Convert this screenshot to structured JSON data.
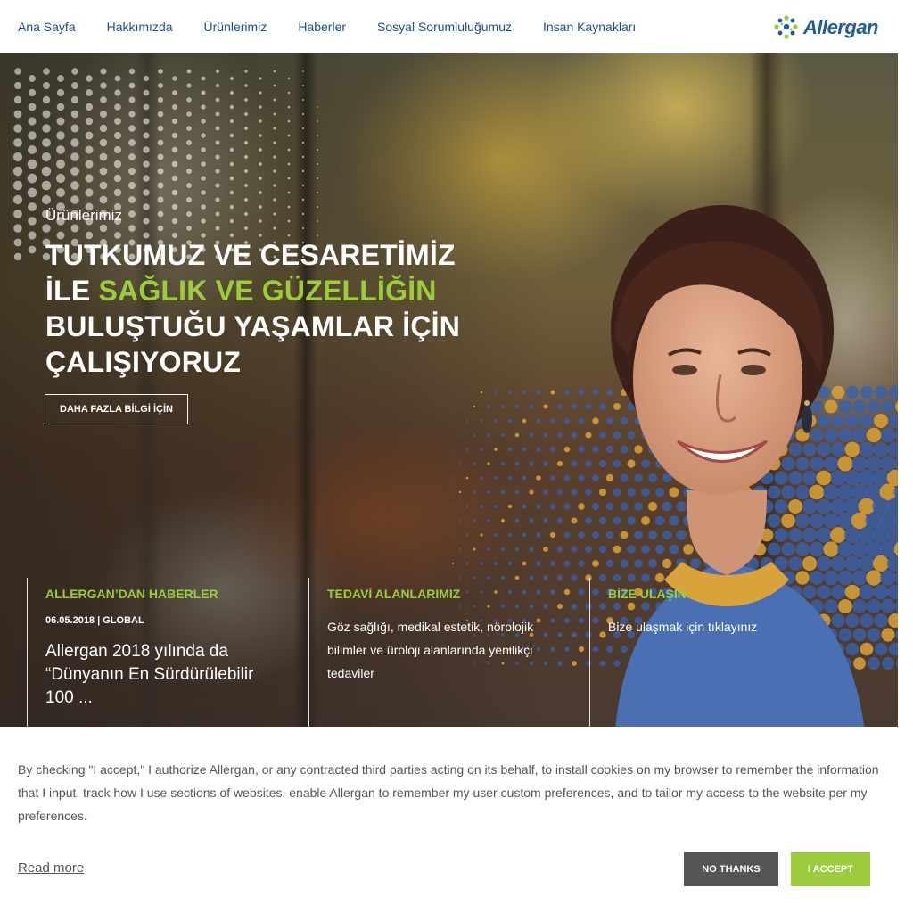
{
  "nav": {
    "items": [
      {
        "label": "Ana Sayfa"
      },
      {
        "label": "Hakkımızda"
      },
      {
        "label": "Ürünlerimiz"
      },
      {
        "label": "Haberler"
      },
      {
        "label": "Sosyal Sorumluluğumuz"
      },
      {
        "label": "İnsan Kaynakları"
      }
    ],
    "brand_name": "Allergan"
  },
  "hero": {
    "eyebrow": "Ürünlerimiz",
    "title_line1": "TUTKUMUZ VE CESARETİMİZ",
    "title_line2_a": "İLE ",
    "title_line2_b": "SAĞLIK VE GÜZELLİĞİN",
    "title_line3": "BULUŞTUĞU YAŞAMLAR İÇİN",
    "title_line4": "ÇALIŞIYORUZ",
    "button_label": "DAHA FAZLA BİLGİ İÇİN"
  },
  "columns": {
    "news": {
      "heading": "ALLERGAN’DAN HABERLER",
      "meta": "06.05.2018 | GLOBAL",
      "headline": "Allergan 2018 yılında da “Dünyanın En Sürdürülebilir 100 ..."
    },
    "areas": {
      "heading": "TEDAVİ ALANLARIMIZ",
      "body": "Göz sağlığı, medikal estetik, nörolojik bilimler ve üroloji alanlarında yenilikçi tedaviler"
    },
    "contact": {
      "heading": "BİZE ULAŞIN",
      "body": "Bize ulaşmak için tıklayınız"
    }
  },
  "cookie": {
    "text": "By checking \"I accept,\" I authorize Allergan, or any contracted third parties acting on its behalf, to install cookies on my browser to remember the information that I input, track how I use sections of websites, enable Allergan to remember my user custom preferences, and to tailor my access to the website per my preferences.",
    "read_more": "Read more",
    "no_thanks": "NO THANKS",
    "accept": "I ACCEPT"
  },
  "colors": {
    "accent_green": "#9bcc3c",
    "nav_blue": "#1f4e8f",
    "dark_button": "#555555"
  }
}
